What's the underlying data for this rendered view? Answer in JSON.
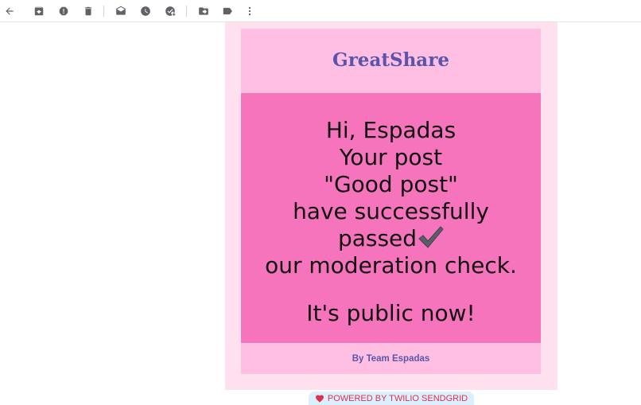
{
  "toolbar": {
    "icons": [
      "back-arrow-icon",
      "archive-icon",
      "report-spam-icon",
      "delete-icon",
      "mark-unread-icon",
      "snooze-icon",
      "add-to-tasks-icon",
      "move-to-icon",
      "labels-icon",
      "more-options-icon"
    ],
    "icon_color": "#5f6368"
  },
  "email": {
    "brand": "GreatShare",
    "greeting": "Hi, Espadas",
    "line2": "Your post",
    "post_title": "\"Good post\"",
    "line4": "have successfully",
    "line5": "passed",
    "line6": "our moderation check.",
    "line7": "It's public now!",
    "signature": "By Team Espadas",
    "colors": {
      "outer": "#ffe0ee",
      "header": "#ffbfe3",
      "body": "#f674bb",
      "brand_text": "#5a55aa"
    }
  },
  "powered_by": {
    "label": "POWERED BY TWILIO SENDGRID",
    "color": "#e0304a"
  }
}
